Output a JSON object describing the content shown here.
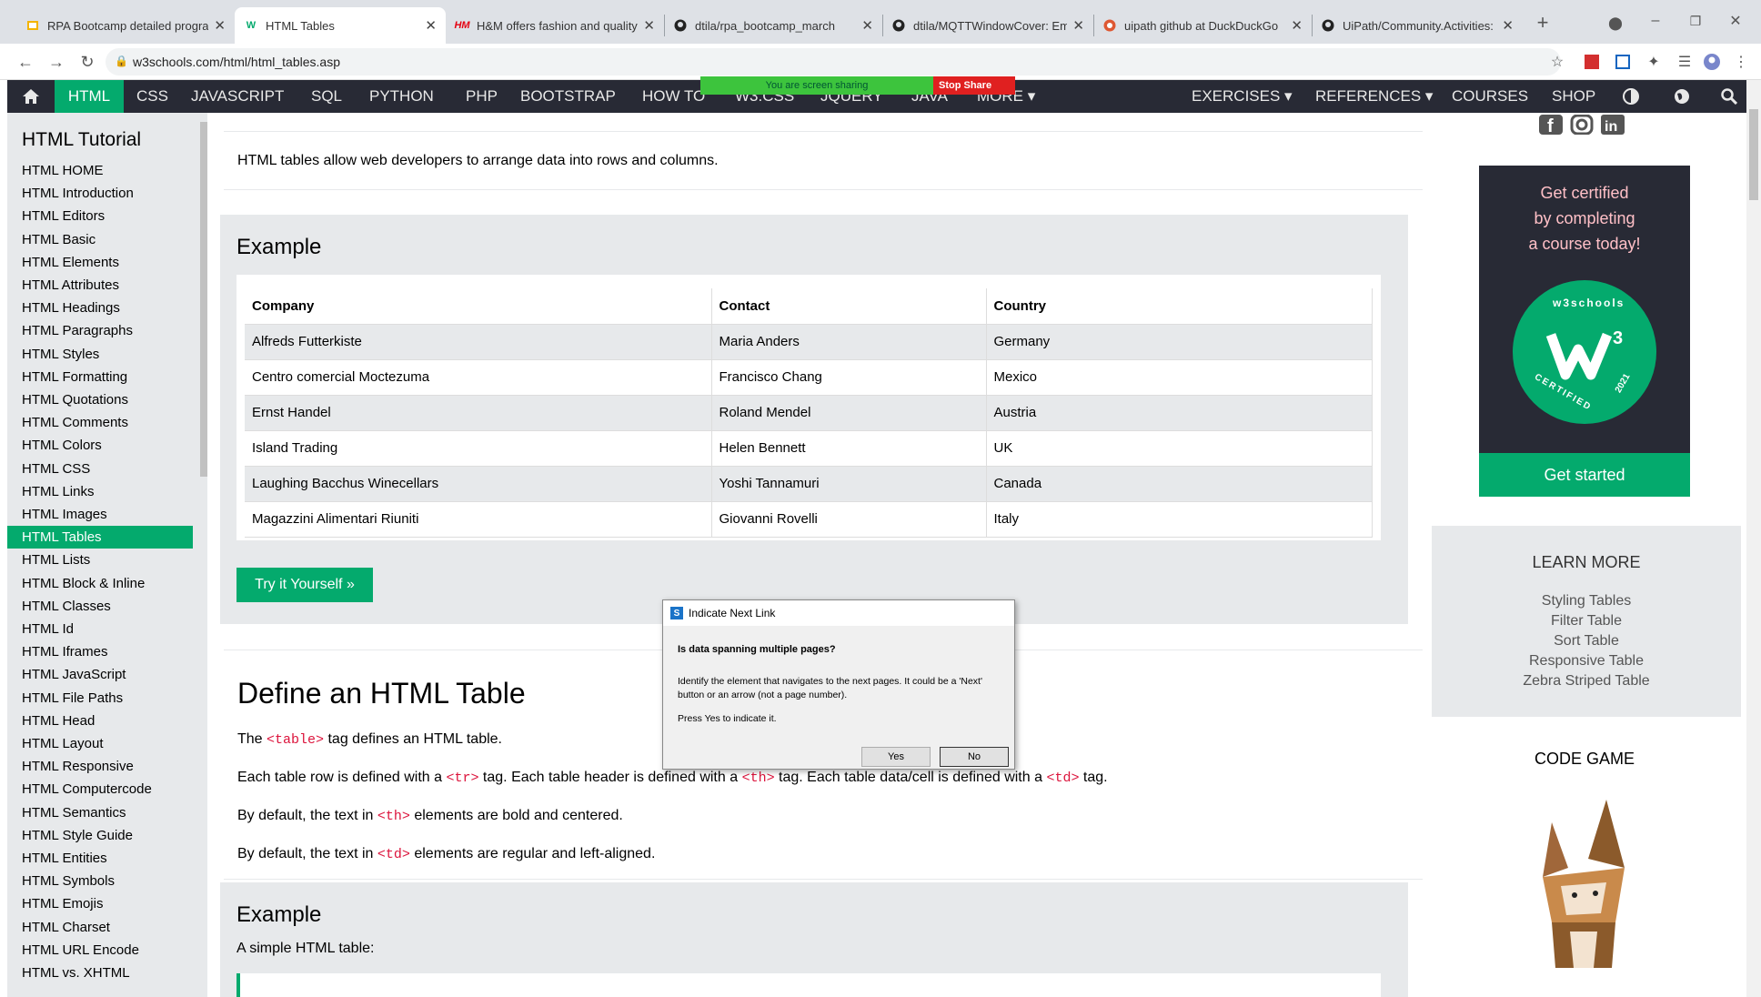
{
  "browser": {
    "tabs": [
      {
        "title": "RPA Bootcamp detailed program",
        "icon": "slides-icon"
      },
      {
        "title": "HTML Tables",
        "icon": "w3schools-icon"
      },
      {
        "title": "H&M offers fashion and quality",
        "icon": "hm-icon"
      },
      {
        "title": "dtila/rpa_bootcamp_march",
        "icon": "github-icon"
      },
      {
        "title": "dtila/MQTTWindowCover: Emul",
        "icon": "github-icon"
      },
      {
        "title": "uipath github at DuckDuckGo",
        "icon": "duckduckgo-icon"
      },
      {
        "title": "UiPath/Community.Activities: Re",
        "icon": "github-icon"
      }
    ],
    "url": "w3schools.com/html/html_tables.asp"
  },
  "screen_share": {
    "text": "You are screen sharing",
    "stop": "Stop Share"
  },
  "topnav": {
    "home": "home-icon",
    "items": [
      "HTML",
      "CSS",
      "JAVASCRIPT",
      "SQL",
      "PYTHON",
      "PHP",
      "BOOTSTRAP",
      "HOW TO",
      "W3.CSS",
      "JQUERY",
      "JAVA",
      "MORE ▾"
    ],
    "right": [
      "EXERCISES ▾",
      "REFERENCES ▾",
      "COURSES",
      "SHOP"
    ]
  },
  "sidebar": {
    "title": "HTML Tutorial",
    "items": [
      "HTML HOME",
      "HTML Introduction",
      "HTML Editors",
      "HTML Basic",
      "HTML Elements",
      "HTML Attributes",
      "HTML Headings",
      "HTML Paragraphs",
      "HTML Styles",
      "HTML Formatting",
      "HTML Quotations",
      "HTML Comments",
      "HTML Colors",
      "HTML CSS",
      "HTML Links",
      "HTML Images",
      "HTML Tables",
      "HTML Lists",
      "HTML Block & Inline",
      "HTML Classes",
      "HTML Id",
      "HTML Iframes",
      "HTML JavaScript",
      "HTML File Paths",
      "HTML Head",
      "HTML Layout",
      "HTML Responsive",
      "HTML Computercode",
      "HTML Semantics",
      "HTML Style Guide",
      "HTML Entities",
      "HTML Symbols",
      "HTML Emojis",
      "HTML Charset",
      "HTML URL Encode",
      "HTML vs. XHTML"
    ],
    "selected_index": 16
  },
  "main": {
    "intro": "HTML tables allow web developers to arrange data into rows and columns.",
    "example_heading": "Example",
    "table": {
      "headers": [
        "Company",
        "Contact",
        "Country"
      ],
      "rows": [
        [
          "Alfreds Futterkiste",
          "Maria Anders",
          "Germany"
        ],
        [
          "Centro comercial Moctezuma",
          "Francisco Chang",
          "Mexico"
        ],
        [
          "Ernst Handel",
          "Roland Mendel",
          "Austria"
        ],
        [
          "Island Trading",
          "Helen Bennett",
          "UK"
        ],
        [
          "Laughing Bacchus Winecellars",
          "Yoshi Tannamuri",
          "Canada"
        ],
        [
          "Magazzini Alimentari Riuniti",
          "Giovanni Rovelli",
          "Italy"
        ]
      ]
    },
    "try_button": "Try it Yourself »",
    "define_heading": "Define an HTML Table",
    "p1a": "The ",
    "p1code": "<table>",
    "p1b": " tag defines an HTML table.",
    "p2a": "Each table row is defined with a ",
    "p2code1": "<tr>",
    "p2b": " tag. Each table header is defined with a ",
    "p2code2": "<th>",
    "p2c": " tag. Each table data/cell is defined with a ",
    "p2code3": "<td>",
    "p2d": " tag.",
    "p3a": "By default, the text in ",
    "p3code": "<th>",
    "p3b": " elements are bold and centered.",
    "p4a": "By default, the text in ",
    "p4code": "<td>",
    "p4b": " elements are regular and left-aligned.",
    "example2_heading": "Example",
    "example2_text": "A simple HTML table:"
  },
  "right": {
    "cert_text": [
      "Get certified",
      "by completing",
      "a course today!"
    ],
    "badge_text": "w3schools",
    "badge_year": "2021",
    "badge_label": "CERTIFIED",
    "get_started": "Get started",
    "learn_more_title": "LEARN MORE",
    "learn_more": [
      "Styling Tables",
      "Filter Table",
      "Sort Table",
      "Responsive Table",
      "Zebra Striped Table"
    ],
    "code_game": "CODE GAME"
  },
  "dialog": {
    "title": "Indicate Next Link",
    "question": "Is data spanning multiple pages?",
    "description": "Identify the element that navigates to the next pages. It could be a 'Next' button or an arrow (not a page number).",
    "prompt": "Press Yes to indicate it.",
    "yes": "Yes",
    "no": "No"
  },
  "colors": {
    "w3_green": "#04aa6d",
    "nav_dark": "#282a35",
    "sidebar_bg": "#e7e9eb"
  }
}
